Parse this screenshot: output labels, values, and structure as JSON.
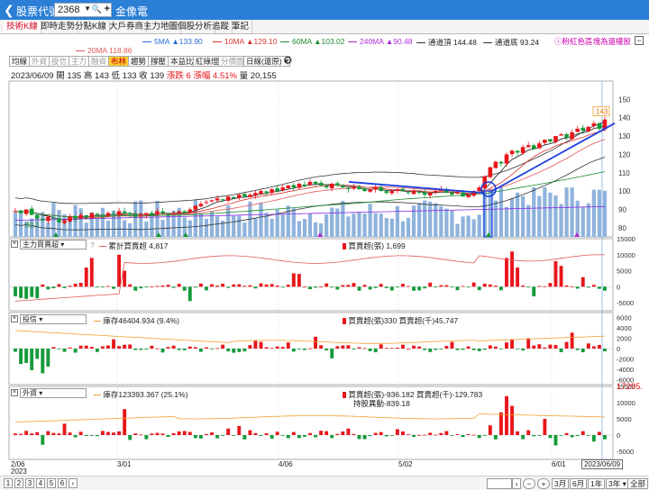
{
  "titlebar": {
    "title": "股票代號",
    "code": "2368",
    "name": "金像電"
  },
  "tabs": [
    "技術K線",
    "即時走勢",
    "分點K線",
    "大戶券商",
    "主力地圖",
    "個股分析",
    "追蹤",
    "筆記"
  ],
  "legend": {
    "ma5": "5MA ▲133.90",
    "ma10": "10MA ▲129.10",
    "ma60": "60MA ▲103.02",
    "ma240": "240MA ▲90.48",
    "upper": "通道頂 144.48",
    "lower": "通道底 93.24",
    "ma20": "20MA 118.86",
    "hint": "ⓘ粉紅色區塊為還權股"
  },
  "toolbar": [
    "均線",
    "外資",
    "投信",
    "主力",
    "融資",
    "布林",
    "趨勢",
    "撐壓",
    "本益比",
    "紅綠燈",
    "分價圖",
    "日線(還原)"
  ],
  "info": {
    "date": "2023/06/09",
    "open_label": "開",
    "open": "135",
    "high_label": "高",
    "high": "143",
    "low_label": "低",
    "low": "133",
    "close_label": "收",
    "close": "139",
    "change": "漲跌 6",
    "pct_label": "漲幅",
    "pct": "4.51%",
    "vol_label": "量",
    "vol": "20,155"
  },
  "panels": {
    "main": {
      "price_tag": "143",
      "low_tag": "82.1"
    },
    "p2": {
      "select": "主力買賣超",
      "q": "?",
      "line_label": "累計買賣超 4,817",
      "bar_label": "買賣超(張) 1,699"
    },
    "p3": {
      "select": "投信",
      "line_label": "庫存46404.934 (9.4%)",
      "bar_label": "買賣超(張)330 買賣超(千)45,747"
    },
    "p4": {
      "select": "外資",
      "line_label": "庫存123393.367 (25.1%)",
      "bar_label": "買賣超(張)-936.182 買賣超(千)-129,783",
      "sub_label": "持股異動-839.18",
      "right_tag": "17295."
    }
  },
  "x_labels": {
    "d1": "2/06",
    "d1y": "2023",
    "d2": "3/01",
    "d3": "4/06",
    "d4": "5/02",
    "d5": "6/01",
    "d6": "2023/06/09"
  },
  "bottom": {
    "pages": [
      "1",
      "2",
      "3",
      "4",
      "5",
      "6"
    ],
    "ranges": [
      "3月",
      "6月",
      "1年",
      "3年"
    ],
    "all": "全部"
  },
  "chart_data": [
    {
      "type": "candlestick",
      "title": "",
      "ylim": [
        75,
        160
      ],
      "yticks": [
        80,
        90,
        100,
        110,
        120,
        130,
        140,
        150
      ],
      "close": [
        89,
        88,
        90,
        87,
        85,
        84,
        86,
        85,
        83,
        84,
        86,
        85,
        87,
        86,
        88,
        87,
        86,
        88,
        87,
        89,
        88,
        87,
        86,
        87,
        88,
        87,
        89,
        88,
        87,
        88,
        89,
        88,
        90,
        92,
        93,
        94,
        95,
        96,
        95,
        97,
        96,
        98,
        97,
        98,
        99,
        100,
        99,
        101,
        100,
        102,
        103,
        102,
        104,
        103,
        105,
        104,
        103,
        102,
        104,
        103,
        102,
        101,
        102,
        101,
        100,
        101,
        102,
        100,
        99,
        100,
        101,
        100,
        99,
        100,
        99,
        98,
        99,
        100,
        101,
        99,
        98,
        99,
        97,
        98,
        100,
        102,
        108,
        113,
        116,
        115,
        120,
        122,
        121,
        124,
        125,
        123,
        126,
        128,
        127,
        130,
        131,
        129,
        132,
        134,
        133,
        135,
        137,
        134,
        139
      ],
      "volume_max_relative": 1.0
    },
    {
      "type": "bar",
      "title": "主力買賣超",
      "ylim": [
        -7500,
        15000
      ],
      "yticks": [
        -5000,
        0,
        5000,
        10000,
        15000
      ]
    },
    {
      "type": "bar",
      "title": "投信",
      "ylim": [
        -7000,
        7000
      ],
      "yticks": [
        -6000,
        -4000,
        -2000,
        0,
        2000,
        4000,
        6000
      ]
    },
    {
      "type": "bar",
      "title": "外資",
      "ylim": [
        -7500,
        15000
      ],
      "yticks": [
        -5000,
        0,
        5000,
        10000,
        15000
      ]
    }
  ],
  "colors": {
    "up": "#e8161b",
    "down": "#159a3a",
    "vol": "#8fb3dd",
    "ma5": "#1a1a1a",
    "ma10": "#d9342b",
    "ma60": "#1e8a2e",
    "ma240": "#8a2be2",
    "trend": "#1b3ee0",
    "accent": "#2b7fd6"
  }
}
